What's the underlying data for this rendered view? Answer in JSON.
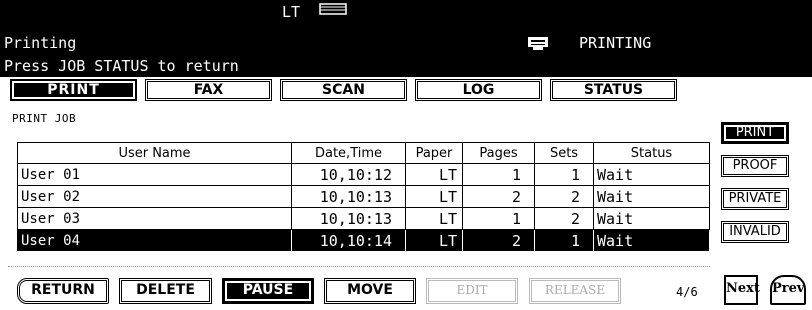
{
  "header": {
    "paper_size": "LT",
    "state": "Printing",
    "printer_status": "PRINTING",
    "hint": "Press JOB STATUS to return"
  },
  "tabs": [
    {
      "label": "PRINT",
      "active": true
    },
    {
      "label": "FAX",
      "active": false
    },
    {
      "label": "SCAN",
      "active": false
    },
    {
      "label": "LOG",
      "active": false
    },
    {
      "label": "STATUS",
      "active": false
    }
  ],
  "section_title": "PRINT JOB",
  "table": {
    "columns": [
      "User Name",
      "Date,Time",
      "Paper",
      "Pages",
      "Sets",
      "Status"
    ],
    "rows": [
      {
        "user": "User 01",
        "datetime": "10,10:12",
        "paper": "LT",
        "pages": "1",
        "sets": "1",
        "status": "Wait",
        "selected": false
      },
      {
        "user": "User 02",
        "datetime": "10,10:13",
        "paper": "LT",
        "pages": "2",
        "sets": "2",
        "status": "Wait",
        "selected": false
      },
      {
        "user": "User 03",
        "datetime": "10,10:13",
        "paper": "LT",
        "pages": "1",
        "sets": "2",
        "status": "Wait",
        "selected": false
      },
      {
        "user": "User 04",
        "datetime": "10,10:14",
        "paper": "LT",
        "pages": "2",
        "sets": "1",
        "status": "Wait",
        "selected": true
      }
    ]
  },
  "side_buttons": [
    {
      "label": "PRINT",
      "active": true
    },
    {
      "label": "PROOF",
      "active": false
    },
    {
      "label": "PRIVATE",
      "active": false
    },
    {
      "label": "INVALID",
      "active": false
    }
  ],
  "actions": {
    "return": "RETURN",
    "delete": "DELETE",
    "pause": "PAUSE",
    "move": "MOVE",
    "edit": "EDIT",
    "release": "RELEASE"
  },
  "pagination": {
    "indicator": "4/6",
    "next": "Next",
    "prev": "Prev"
  }
}
